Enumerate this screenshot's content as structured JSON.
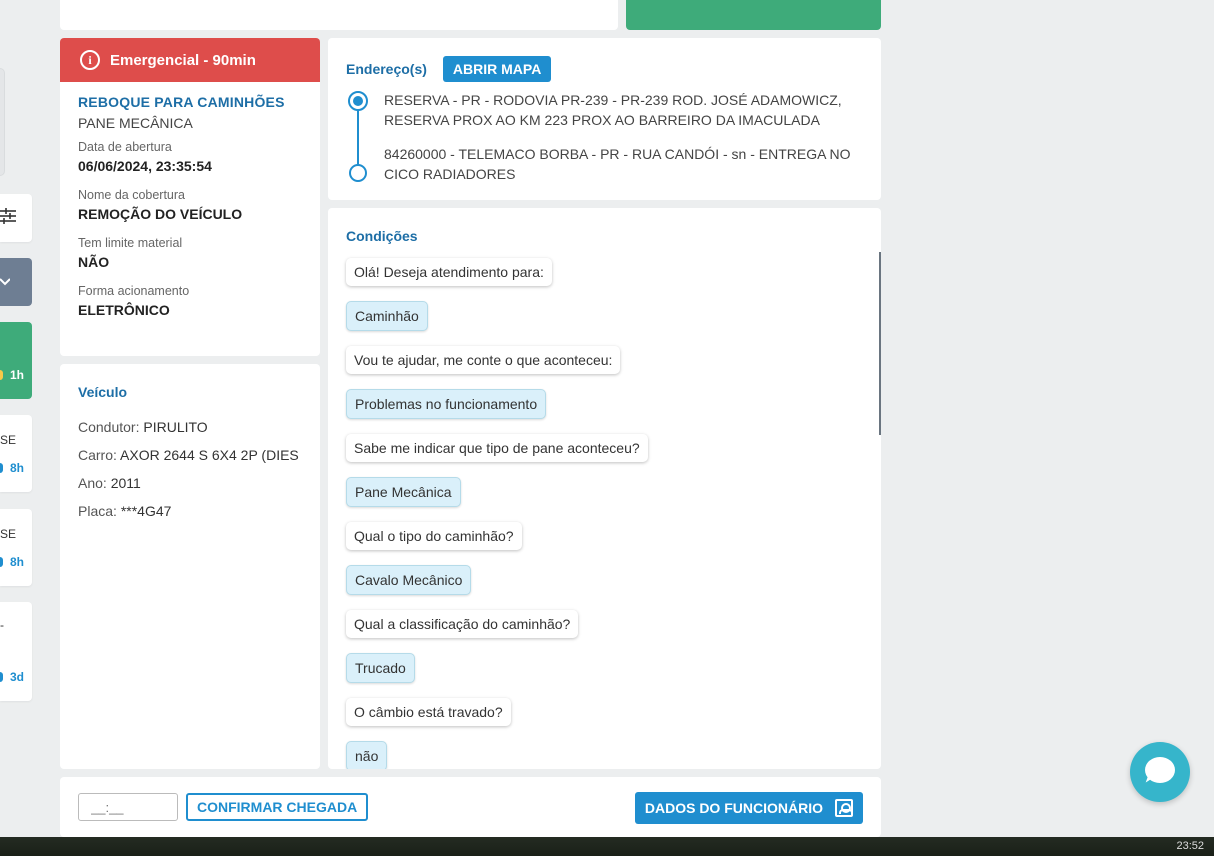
{
  "sidebar": {
    "green_card_time": "1h",
    "cards": [
      {
        "text": "SE",
        "time": "8h"
      },
      {
        "text": "SE",
        "time": "8h"
      },
      {
        "text": "-",
        "time": "3d"
      }
    ]
  },
  "service": {
    "priority": "Emergencial - 90min",
    "title": "REBOQUE PARA CAMINHÕES",
    "subtitle": "PANE MECÂNICA",
    "fields": [
      {
        "label": "Data de abertura",
        "value": "06/06/2024, 23:35:54"
      },
      {
        "label": "Nome da cobertura",
        "value": "REMOÇÃO DO VEÍCULO"
      },
      {
        "label": "Tem limite material",
        "value": "NÃO"
      },
      {
        "label": "Forma acionamento",
        "value": "ELETRÔNICO"
      }
    ]
  },
  "vehicle": {
    "heading": "Veículo",
    "rows": [
      {
        "label": "Condutor:",
        "value": "PIRULITO"
      },
      {
        "label": "Carro:",
        "value": "AXOR 2644 S 6X4 2P (DIES"
      },
      {
        "label": "Ano:",
        "value": "2011"
      },
      {
        "label": "Placa:",
        "value": "***4G47"
      }
    ]
  },
  "address": {
    "heading": "Endereço(s)",
    "map_button": "ABRIR MAPA",
    "origin": "RESERVA - PR - RODOVIA PR-239 - PR-239 ROD. JOSÉ ADAMOWICZ, RESERVA PROX AO KM 223 PROX AO BARREIRO DA IMACULADA",
    "destination": "84260000 - TELEMACO BORBA - PR - RUA CANDÓI - sn - ENTREGA NO CICO RADIADORES"
  },
  "conditions": {
    "heading": "Condições",
    "messages": [
      {
        "type": "q",
        "text": "Olá! Deseja atendimento para:"
      },
      {
        "type": "a",
        "text": "Caminhão"
      },
      {
        "type": "q",
        "text": "Vou te ajudar, me conte o que aconteceu:"
      },
      {
        "type": "a",
        "text": "Problemas no funcionamento"
      },
      {
        "type": "q",
        "text": "Sabe me indicar que tipo de pane aconteceu?"
      },
      {
        "type": "a",
        "text": "Pane Mecânica"
      },
      {
        "type": "q",
        "text": "Qual o tipo do caminhão?"
      },
      {
        "type": "a",
        "text": "Cavalo Mecânico"
      },
      {
        "type": "q",
        "text": "Qual a classificação do caminhão?"
      },
      {
        "type": "a",
        "text": "Trucado"
      },
      {
        "type": "q",
        "text": "O câmbio está travado?"
      },
      {
        "type": "a",
        "text": "não"
      }
    ]
  },
  "footer": {
    "time_placeholder": "__:__",
    "confirm_label": "CONFIRMAR CHEGADA",
    "employee_label": "DADOS DO FUNCIONÁRIO"
  },
  "taskbar": {
    "clock": "23:52"
  },
  "colors": {
    "emergency": "#de4d4b",
    "accent_blue": "#1f8ecf",
    "success_green": "#3eab7a",
    "chat_fab": "#36b5cb"
  },
  "icons": [
    "info-icon",
    "filter-sliders-icon",
    "chevron-down-icon",
    "origin-marker-icon",
    "destination-marker-icon",
    "employee-badge-icon",
    "chat-bubble-icon"
  ]
}
